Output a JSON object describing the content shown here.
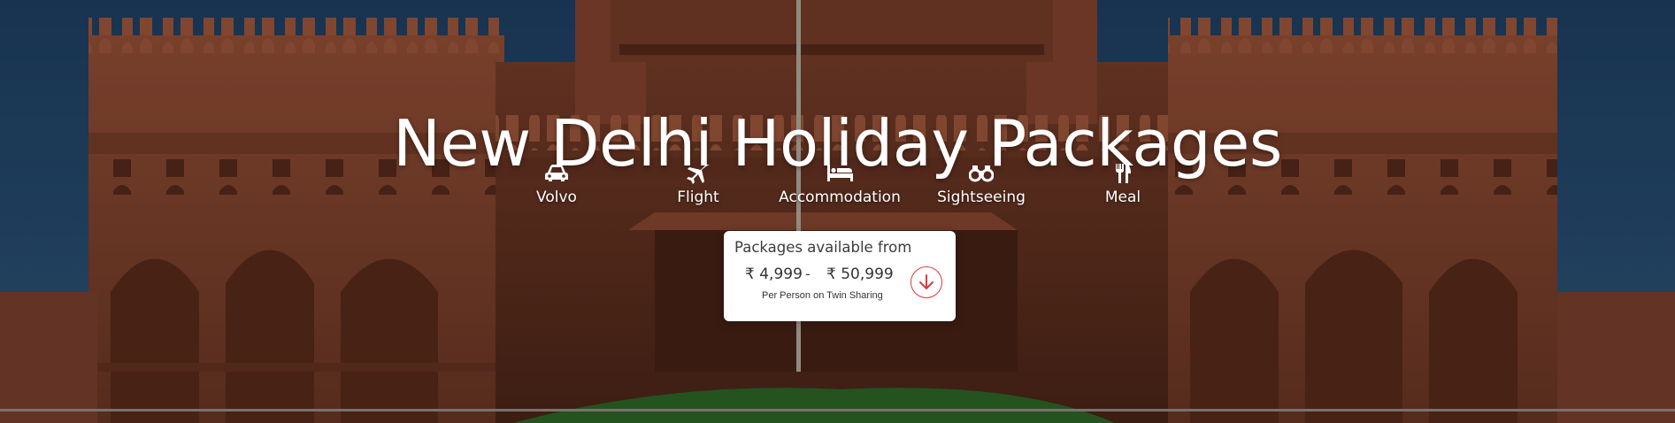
{
  "hero": {
    "title": "New Delhi Holiday Packages"
  },
  "inclusions": [
    {
      "icon": "car-icon",
      "label": "Volvo"
    },
    {
      "icon": "plane-icon",
      "label": "Flight"
    },
    {
      "icon": "bed-icon",
      "label": "Accommodation"
    },
    {
      "icon": "binoculars-icon",
      "label": "Sightseeing"
    },
    {
      "icon": "fork-knife-icon",
      "label": "Meal"
    }
  ],
  "price_card": {
    "heading": "Packages available from",
    "currency_symbol": "₹",
    "min_price": "4,999",
    "separator": "-",
    "max_price": "50,999",
    "note": "Per Person on Twin Sharing",
    "action_icon": "arrow-down-circle-icon"
  },
  "colors": {
    "accent": "#e0383e",
    "sky": "#244a6d",
    "sandstone": "#8e4a33"
  }
}
